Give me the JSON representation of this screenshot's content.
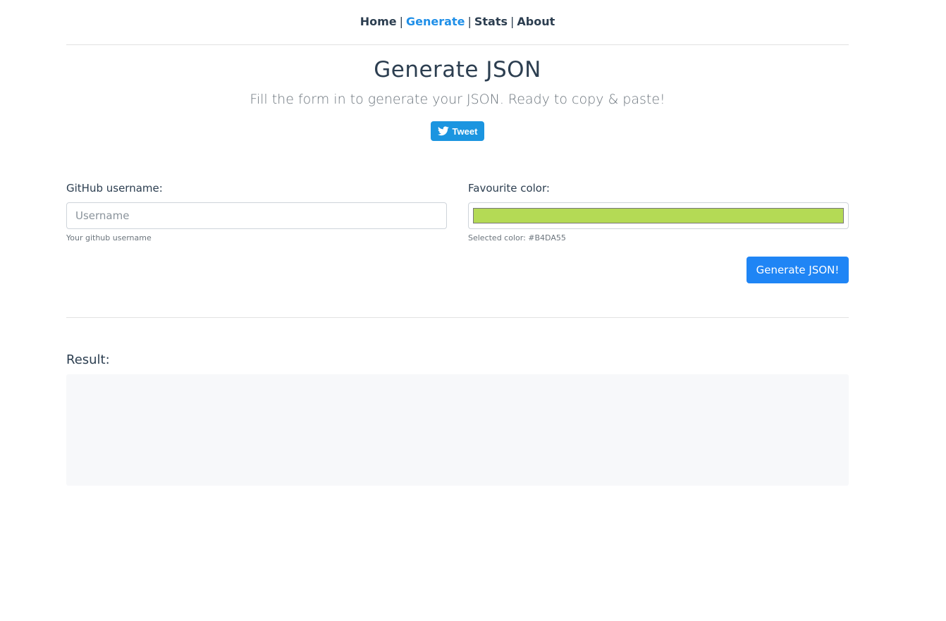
{
  "nav": {
    "items": [
      {
        "label": "Home"
      },
      {
        "label": "Generate"
      },
      {
        "label": "Stats"
      },
      {
        "label": "About"
      }
    ],
    "separator": "|",
    "active": "Generate"
  },
  "header": {
    "title": "Generate JSON",
    "subtitle": "Fill the form in to generate your JSON. Ready to copy & paste!"
  },
  "tweet": {
    "label": "Tweet",
    "icon": "twitter-bird-icon"
  },
  "form": {
    "username": {
      "label": "GitHub username:",
      "placeholder": "Username",
      "value": "",
      "help": "Your github username"
    },
    "color": {
      "label": "Favourite color:",
      "value": "#B4DA55",
      "help": "Selected color: #B4DA55"
    },
    "submit_label": "Generate JSON!"
  },
  "result": {
    "label": "Result:",
    "content": ""
  },
  "colors": {
    "accent": "#1f85f5",
    "nav_active": "#1f8fe8",
    "tweet": "#1b95e0",
    "text": "#2c3e50",
    "selected_color": "#B4DA55"
  }
}
